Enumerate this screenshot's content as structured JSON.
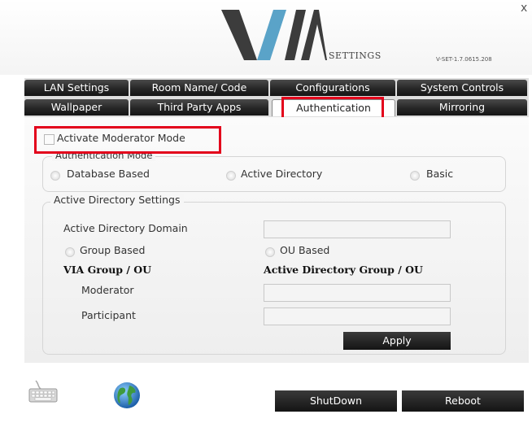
{
  "header": {
    "close_glyph": "x",
    "logo_text": "VIA",
    "settings_word": "SETTINGS",
    "version": "V-SET-1.7.0615.208"
  },
  "tabs": {
    "row1": [
      "LAN Settings",
      "Room Name/ Code",
      "Configurations",
      "System Controls"
    ],
    "row2": [
      "Wallpaper",
      "Third Party Apps",
      "Authentication",
      "Mirroring"
    ],
    "active": "Authentication"
  },
  "auth": {
    "activate_moderator": "Activate Moderator Mode",
    "activate_checked": false,
    "mode_legend": "Authentication Mode",
    "modes": [
      "Database Based",
      "Active Directory",
      "Basic"
    ],
    "ad_legend": "Active Directory Settings",
    "ad_domain_label": "Active Directory Domain",
    "ad_domain_value": "",
    "group_based": "Group Based",
    "ou_based": "OU Based",
    "via_group_ou": "VIA Group / OU",
    "ad_group_ou": "Active Directory Group / OU",
    "moderator_label": "Moderator",
    "moderator_value": "",
    "participant_label": "Participant",
    "participant_value": "",
    "apply": "Apply"
  },
  "footer": {
    "icons": [
      "keyboard-icon",
      "globe-icon"
    ],
    "shutdown": "ShutDown",
    "reboot": "Reboot"
  },
  "colors": {
    "tab_dark": "#1e1e1e",
    "highlight_red": "#e3001b",
    "logo_blue": "#5aa3c8",
    "logo_gray": "#3c3c3c"
  }
}
